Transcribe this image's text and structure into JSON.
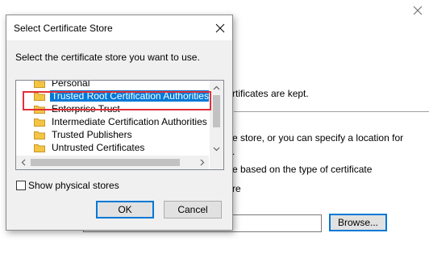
{
  "background": {
    "line1": "rtificates are kept.",
    "line2": "e store, or you can specify a location for",
    "line3": ".",
    "line4": "e based on the type of certificate",
    "line5": "re",
    "browse_label": "Browse..."
  },
  "dialog": {
    "title": "Select Certificate Store",
    "prompt": "Select the certificate store you want to use.",
    "tree": {
      "items": [
        {
          "label": "Personal",
          "selected": false
        },
        {
          "label": "Trusted Root Certification Authorities",
          "selected": true
        },
        {
          "label": "Enterprise Trust",
          "selected": false
        },
        {
          "label": "Intermediate Certification Authorities",
          "selected": false
        },
        {
          "label": "Trusted Publishers",
          "selected": false
        },
        {
          "label": "Untrusted Certificates",
          "selected": false
        }
      ]
    },
    "show_physical_label": "Show physical stores",
    "show_physical_checked": false,
    "ok_label": "OK",
    "cancel_label": "Cancel"
  },
  "colors": {
    "selection": "#0078d7",
    "highlight_box": "#e0303a",
    "dialog_bg": "#f0f0f0",
    "folder_yellow": "#f4c542"
  }
}
